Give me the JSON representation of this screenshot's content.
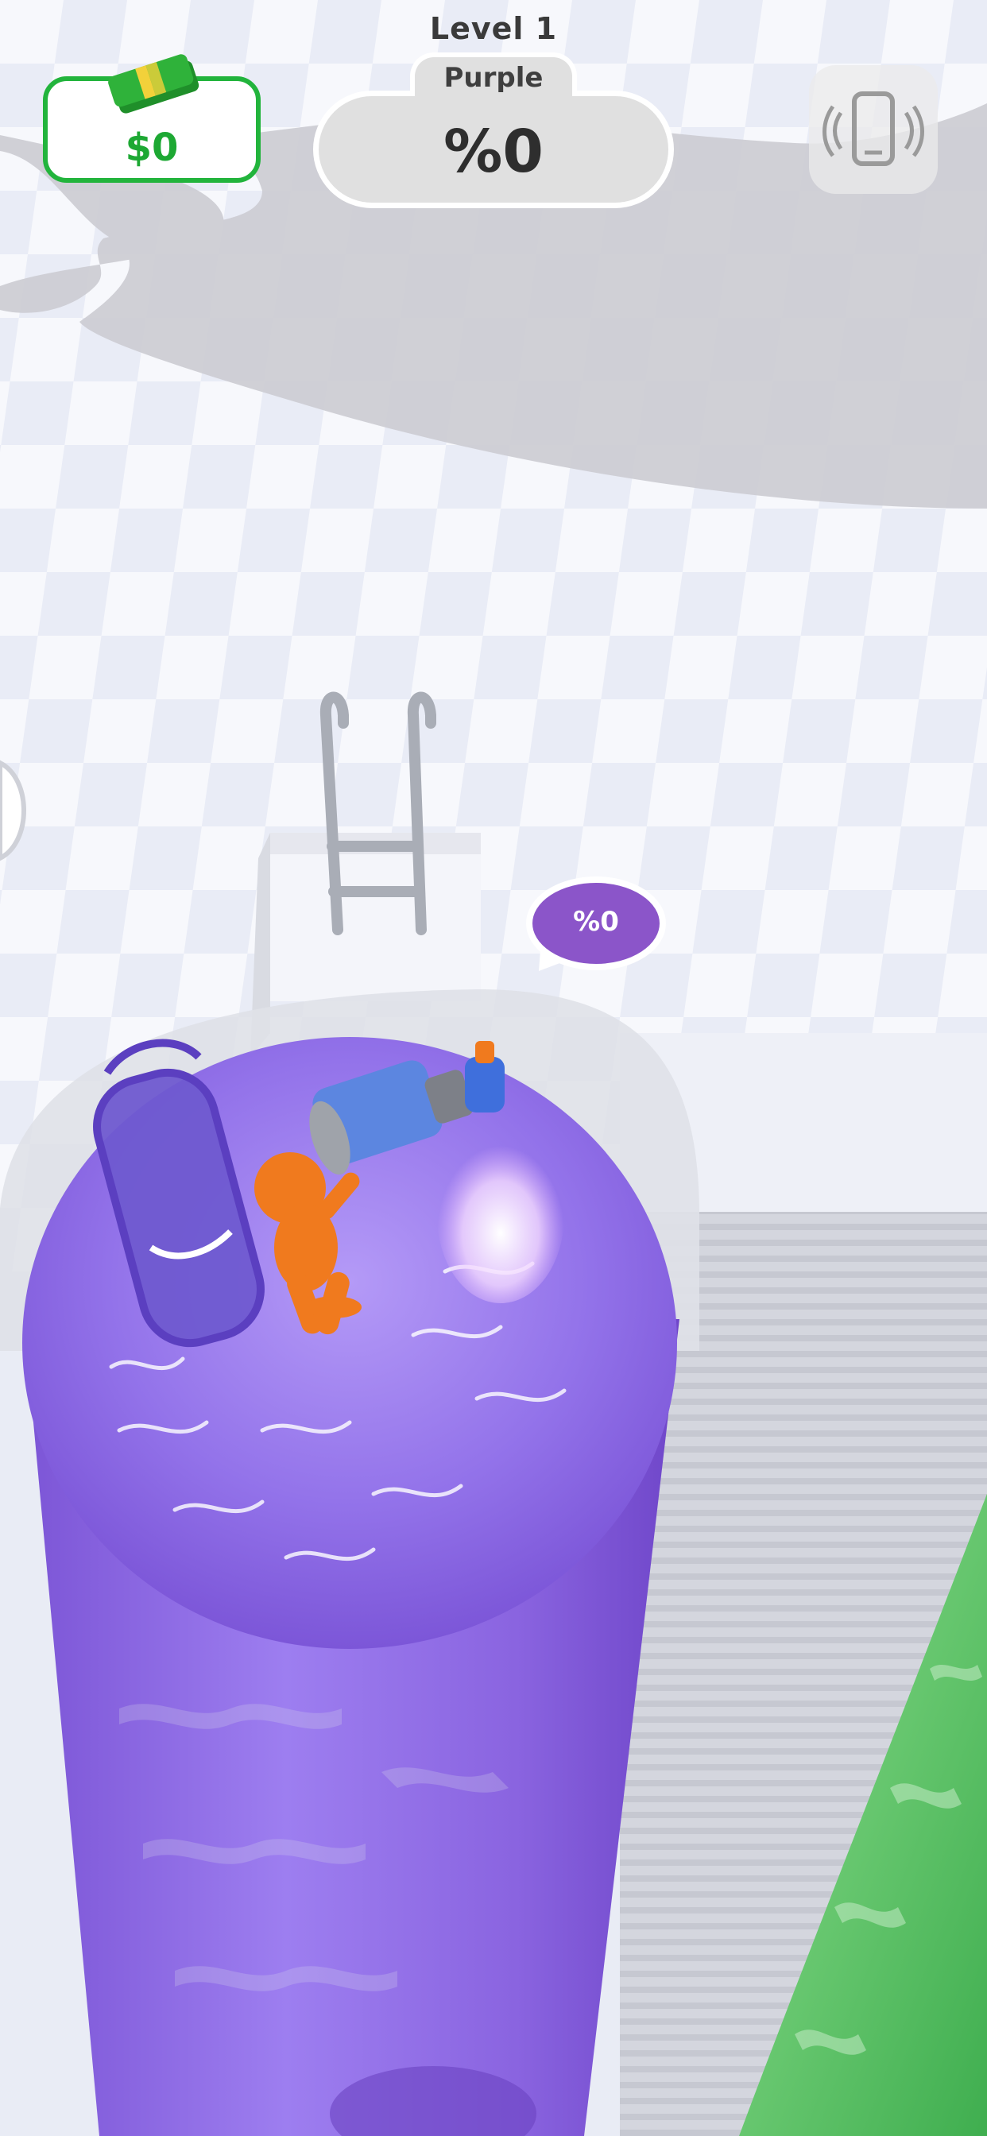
{
  "hud": {
    "level": "Level 1",
    "money": "$0",
    "color_name": "Purple",
    "fill_percent": "%0",
    "vibration_icon": "phone-vibrate-icon",
    "cash_icon": "cash-stack-icon"
  },
  "scene": {
    "tank_percent_bubble": "%0"
  },
  "colors": {
    "money_green": "#22b43c",
    "liquid_purple": "#8f6ee6",
    "character_orange": "#f07a1e",
    "bubble_purple": "#8b55c9",
    "green_liquid": "#5ecb6c"
  }
}
